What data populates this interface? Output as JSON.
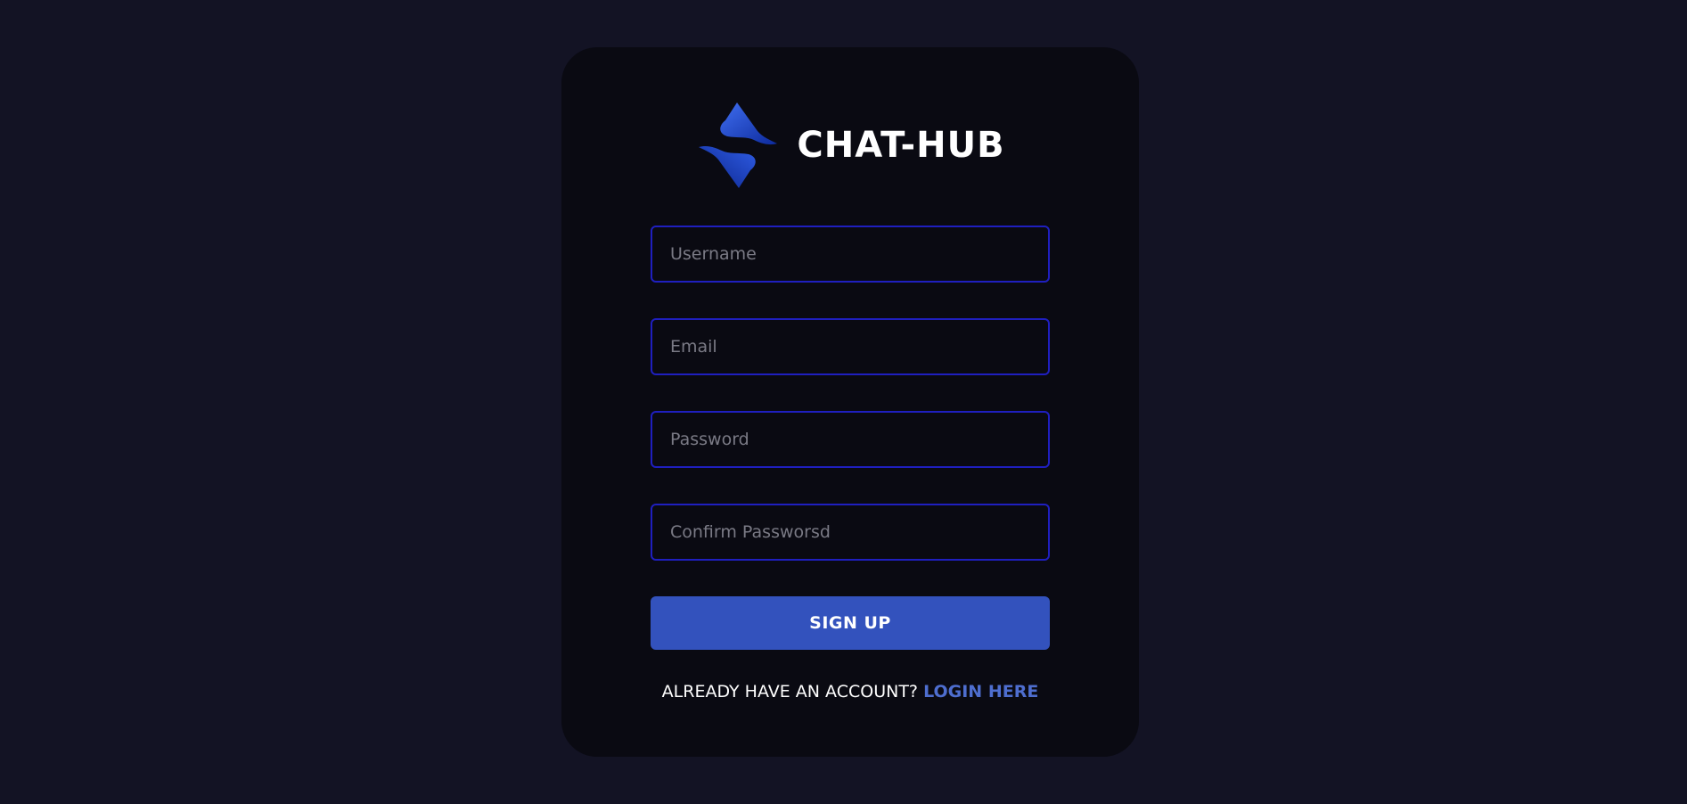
{
  "brand": {
    "title": "CHAT-HUB",
    "logo_icon": "chat-hub-logo-icon"
  },
  "form": {
    "username_placeholder": "Username",
    "email_placeholder": "Email",
    "password_placeholder": "Password",
    "confirm_password_placeholder": "Confirm Passworsd",
    "username_value": "",
    "email_value": "",
    "password_value": "",
    "confirm_password_value": "",
    "submit_label": "SIGN UP"
  },
  "footer": {
    "prompt": "ALREADY HAVE AN ACCOUNT?",
    "link_label": "LOGIN HERE"
  },
  "colors": {
    "page_background": "#131324",
    "card_background": "#0a0a12",
    "input_border": "#1f1fbf",
    "button_background": "#3352bd",
    "link_color": "#4e6ecf"
  }
}
